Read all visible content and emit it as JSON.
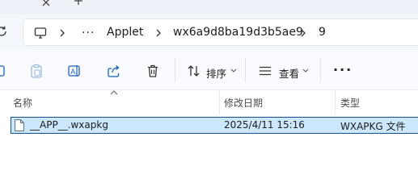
{
  "breadcrumb": {
    "more": "···",
    "items": [
      "Applet",
      "wx6a9d8ba19d3b5ae9",
      "9"
    ]
  },
  "toolbar": {
    "sort_label": "排序",
    "view_label": "查看",
    "more": "···"
  },
  "columns": {
    "name": "名称",
    "modified": "修改日期",
    "type": "类型"
  },
  "files": [
    {
      "name": "__APP__.wxapkg",
      "modified": "2025/4/11 15:16",
      "type": "WXAPKG 文件"
    }
  ],
  "colors": {
    "selection_bg": "#cce8ff",
    "selection_border": "#1b4f8a",
    "accent": "#0067c0"
  }
}
